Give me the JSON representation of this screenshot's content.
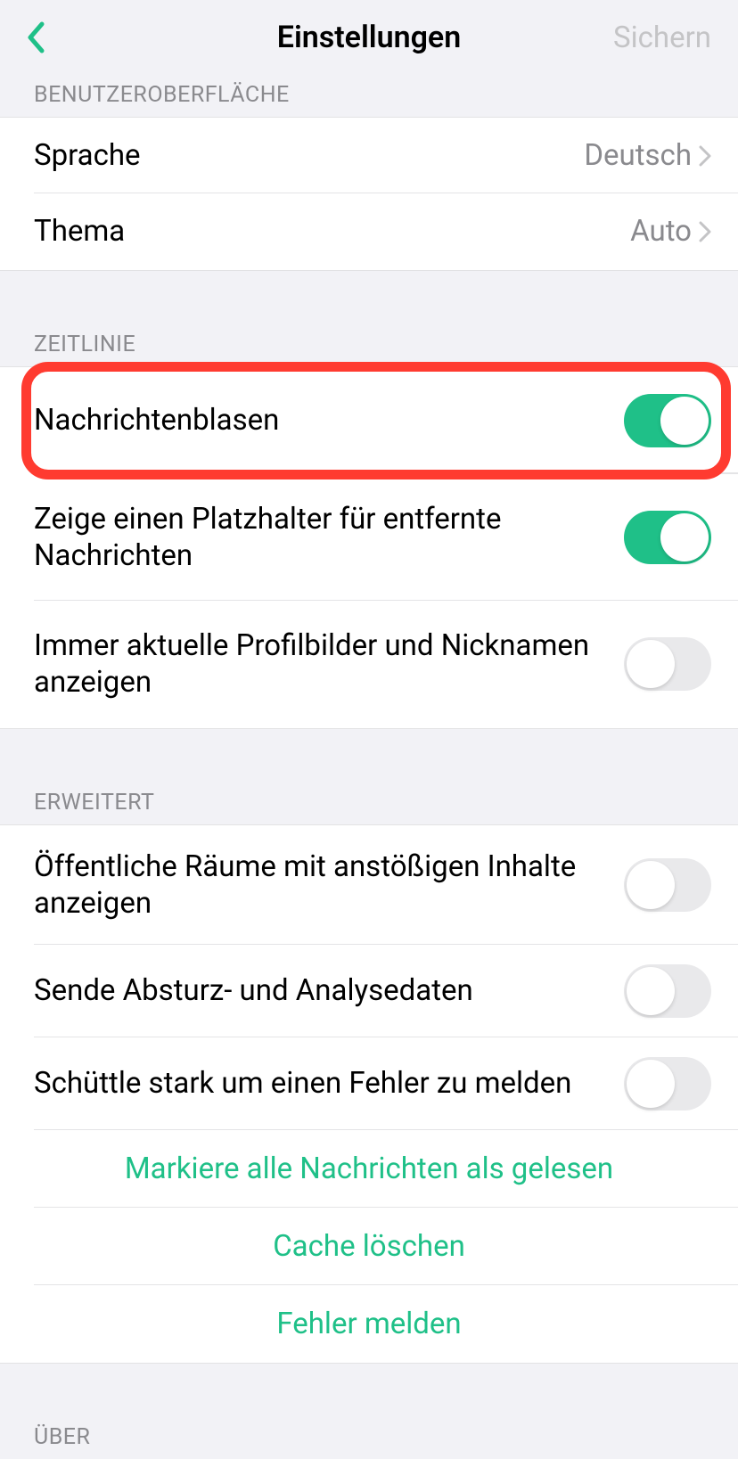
{
  "header": {
    "title": "Einstellungen",
    "save_label": "Sichern"
  },
  "sections": {
    "ui": {
      "header": "BENUTZEROBERFLÄCHE",
      "language_label": "Sprache",
      "language_value": "Deutsch",
      "theme_label": "Thema",
      "theme_value": "Auto"
    },
    "timeline": {
      "header": "ZEITLINIE",
      "message_bubbles_label": "Nachrichtenblasen",
      "placeholder_label": "Zeige einen Platzhalter für entfernte Nachrichten",
      "current_profiles_label": "Immer aktuelle Profilbilder und Nicknamen anzeigen"
    },
    "advanced": {
      "header": "ERWEITERT",
      "public_rooms_label": "Öffentliche Räume mit anstößigen Inhalte anzeigen",
      "crash_data_label": "Sende Absturz- und Analysedaten",
      "shake_report_label": "Schüttle stark um einen Fehler zu melden",
      "mark_read_label": "Markiere alle Nachrichten als gelesen",
      "clear_cache_label": "Cache löschen",
      "report_bug_label": "Fehler melden"
    },
    "about": {
      "header": "ÜBER"
    }
  }
}
